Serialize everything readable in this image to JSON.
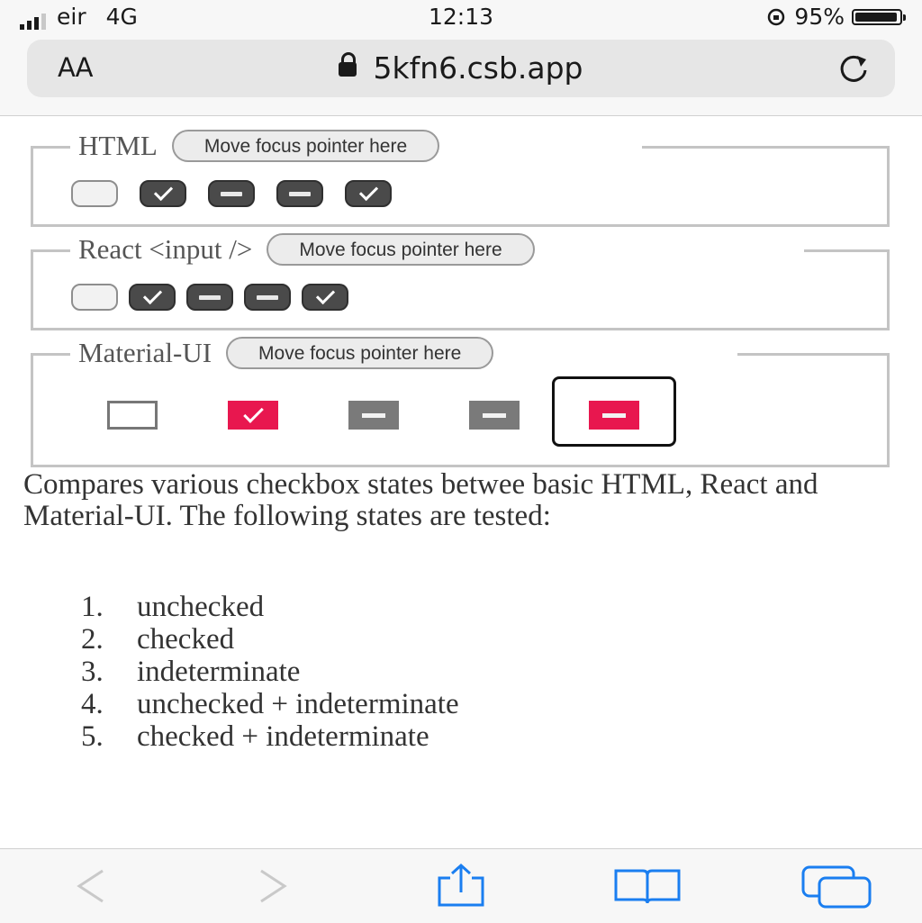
{
  "status_bar": {
    "carrier": "eir",
    "network": "4G",
    "time": "12:13",
    "battery_percent": "95%",
    "battery_level": 0.95
  },
  "browser": {
    "text_size_label": "AA",
    "url": "5kfn6.csb.app"
  },
  "sections": [
    {
      "legend": "HTML",
      "button": "Move focus pointer here",
      "checkbox_states": [
        "unchecked",
        "checked",
        "indeterminate",
        "indeterminate",
        "checked"
      ]
    },
    {
      "legend": "React <input />",
      "button": "Move focus pointer here",
      "checkbox_states": [
        "unchecked",
        "checked",
        "indeterminate",
        "indeterminate",
        "checked"
      ]
    },
    {
      "legend": "Material-UI",
      "button": "Move focus pointer here",
      "checkbox_states": [
        "unchecked",
        "checked",
        "indeterminate",
        "indeterminate",
        "indeterminate"
      ],
      "focused_index": 4
    }
  ],
  "description": "Compares various checkbox states betwee basic HTML, React and Material-UI. The following states are tested:",
  "states_list": [
    {
      "num": "1.",
      "text": "unchecked"
    },
    {
      "num": "2.",
      "text": "checked"
    },
    {
      "num": "3.",
      "text": "indeterminate"
    },
    {
      "num": "4.",
      "text": "unchecked + indeterminate"
    },
    {
      "num": "5.",
      "text": "checked + indeterminate"
    }
  ],
  "colors": {
    "mui_accent": "#e8174f",
    "ios_blue": "#1a7ef0"
  },
  "toolbar": [
    "back-icon",
    "forward-icon",
    "share-icon",
    "bookmarks-icon",
    "tabs-icon"
  ]
}
